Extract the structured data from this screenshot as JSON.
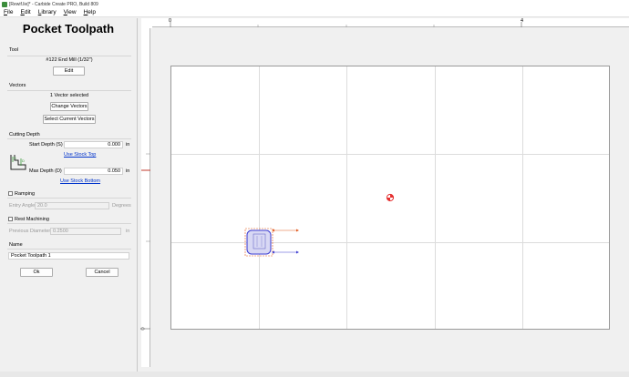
{
  "window": {
    "title": "[Rewif.lie]* - Carbide Create PRO, Build 809"
  },
  "menu": [
    {
      "first": "F",
      "rest": "ile"
    },
    {
      "first": "E",
      "rest": "dit"
    },
    {
      "first": "L",
      "rest": "ibrary"
    },
    {
      "first": "V",
      "rest": "iew"
    },
    {
      "first": "H",
      "rest": "elp"
    }
  ],
  "panel": {
    "title": "Pocket Toolpath",
    "tool": {
      "label": "Tool",
      "name": "#122 End Mill (1/32\")",
      "edit_label": "Edit"
    },
    "vectors": {
      "label": "Vectors",
      "count_text": "1 Vector selected",
      "change_label": "Change Vectors",
      "select_label": "Select Current Vectors"
    },
    "cutting_depth": {
      "label": "Cutting Depth",
      "start_label": "Start Depth (S)",
      "start_value": "0.000",
      "start_unit": "in",
      "use_top": "Use Stock Top",
      "max_label": "Max Depth (D)",
      "max_value": "0.050",
      "max_unit": "in",
      "use_bottom": "Use Stock Bottom"
    },
    "ramping": {
      "label": "Ramping",
      "checked": false,
      "angle_label": "Entry Angle",
      "angle_value": "20.0",
      "angle_unit": "Degrees"
    },
    "rest": {
      "label": "Rest Machining",
      "checked": false,
      "diameter_label": "Previous Diameter",
      "diameter_value": "0.2500",
      "diameter_unit": "in"
    },
    "name": {
      "label": "Name",
      "value": "Pocket Toolpath 1"
    },
    "ok_label": "Ok",
    "cancel_label": "Cancel"
  },
  "rulers": {
    "top_zero": "0",
    "top_four": "4",
    "left_zero": "0"
  },
  "colors": {
    "selection": "#e05a20",
    "vector_fill": "#d8d8f4",
    "vector_stroke": "#3a3ad0",
    "origin": "#e53030",
    "ruler_marker": "#c0392b"
  }
}
